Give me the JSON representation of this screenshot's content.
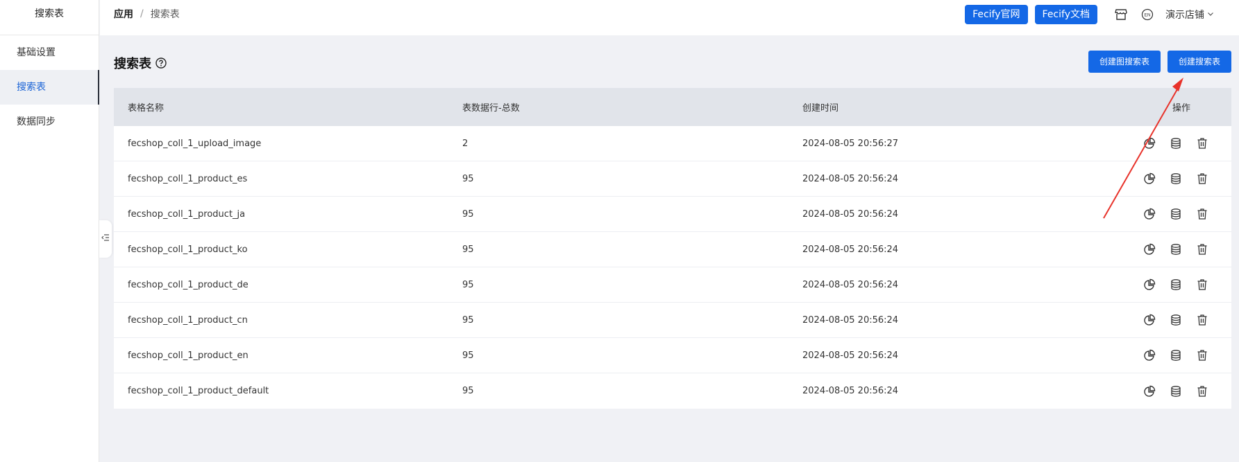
{
  "sidebar": {
    "title": "搜索表",
    "items": [
      {
        "label": "基础设置"
      },
      {
        "label": "搜索表"
      },
      {
        "label": "数据同步"
      }
    ]
  },
  "header": {
    "breadcrumb": {
      "root": "应用",
      "separator": "/",
      "current": "搜索表"
    },
    "btn_official": "Fecify官网",
    "btn_docs": "Fecify文档",
    "store_label": "演示店铺"
  },
  "main": {
    "title": "搜索表",
    "btn_create_image": "创建图搜索表",
    "btn_create": "创建搜索表",
    "table": {
      "headers": [
        "表格名称",
        "表数据行-总数",
        "创建时间",
        "操作"
      ],
      "rows": [
        {
          "name": "fecshop_coll_1_upload_image",
          "count": "2",
          "created": "2024-08-05 20:56:27"
        },
        {
          "name": "fecshop_coll_1_product_es",
          "count": "95",
          "created": "2024-08-05 20:56:24"
        },
        {
          "name": "fecshop_coll_1_product_ja",
          "count": "95",
          "created": "2024-08-05 20:56:24"
        },
        {
          "name": "fecshop_coll_1_product_ko",
          "count": "95",
          "created": "2024-08-05 20:56:24"
        },
        {
          "name": "fecshop_coll_1_product_de",
          "count": "95",
          "created": "2024-08-05 20:56:24"
        },
        {
          "name": "fecshop_coll_1_product_cn",
          "count": "95",
          "created": "2024-08-05 20:56:24"
        },
        {
          "name": "fecshop_coll_1_product_en",
          "count": "95",
          "created": "2024-08-05 20:56:24"
        },
        {
          "name": "fecshop_coll_1_product_default",
          "count": "95",
          "created": "2024-08-05 20:56:24"
        }
      ]
    }
  },
  "colors": {
    "primary": "#1468e6",
    "active_text": "#1a63d6",
    "arrow": "#e8322a",
    "table_header_bg": "#e1e4ea",
    "page_bg": "#f0f1f5"
  },
  "icons": [
    "help-icon",
    "store-icon",
    "language-en-icon",
    "chevron-down-icon",
    "chart-icon",
    "database-icon",
    "trash-icon",
    "collapse-menu-icon"
  ]
}
